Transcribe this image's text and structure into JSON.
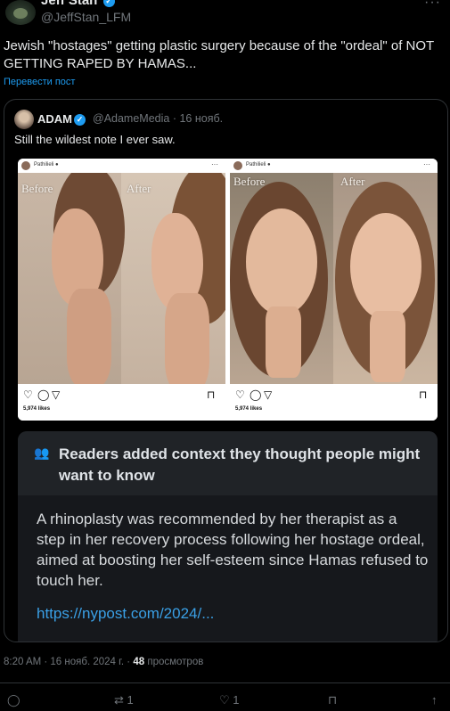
{
  "author": {
    "name": "Jeff Stan",
    "handle": "@JeffStan_LFM",
    "more": "···"
  },
  "tweet": {
    "text": "Jewish \"hostages\" getting plastic surgery because of the \"ordeal\" of NOT GETTING RAPED BY HAMAS...",
    "translate": "Перевести пост"
  },
  "quote": {
    "name": "ADAM",
    "handle": "@AdameMedia",
    "date": "· 16 нояб.",
    "text": "Still the wildest note I ever saw.",
    "image": {
      "left": {
        "username": "Pathilieli ●",
        "before": "Before",
        "after": "After",
        "likes": "5,974 likes"
      },
      "right": {
        "username": "Pathilieli ●",
        "before": "Before",
        "after": "After",
        "likes": "5,974 likes"
      }
    },
    "note": {
      "title": "Readers added context they thought people might want to know",
      "body": "A rhinoplasty was recommended by her therapist as a step in her recovery process following her hostage ordeal, aimed at boosting her self-esteem since Hamas refused to touch her.",
      "link": "https://nypost.com/2024/..."
    }
  },
  "footer": {
    "time": "8:20 AM · 16 нояб. 2024 г. ·",
    "views_count": "48",
    "views_label": "просмотров"
  },
  "actions": {
    "reply_count": "",
    "retweet_count": "1",
    "like_count": "1"
  },
  "colors": {
    "background": "#000000",
    "accent": "#1d9bf0",
    "muted": "#71767b",
    "note_bg": "#16181c"
  }
}
